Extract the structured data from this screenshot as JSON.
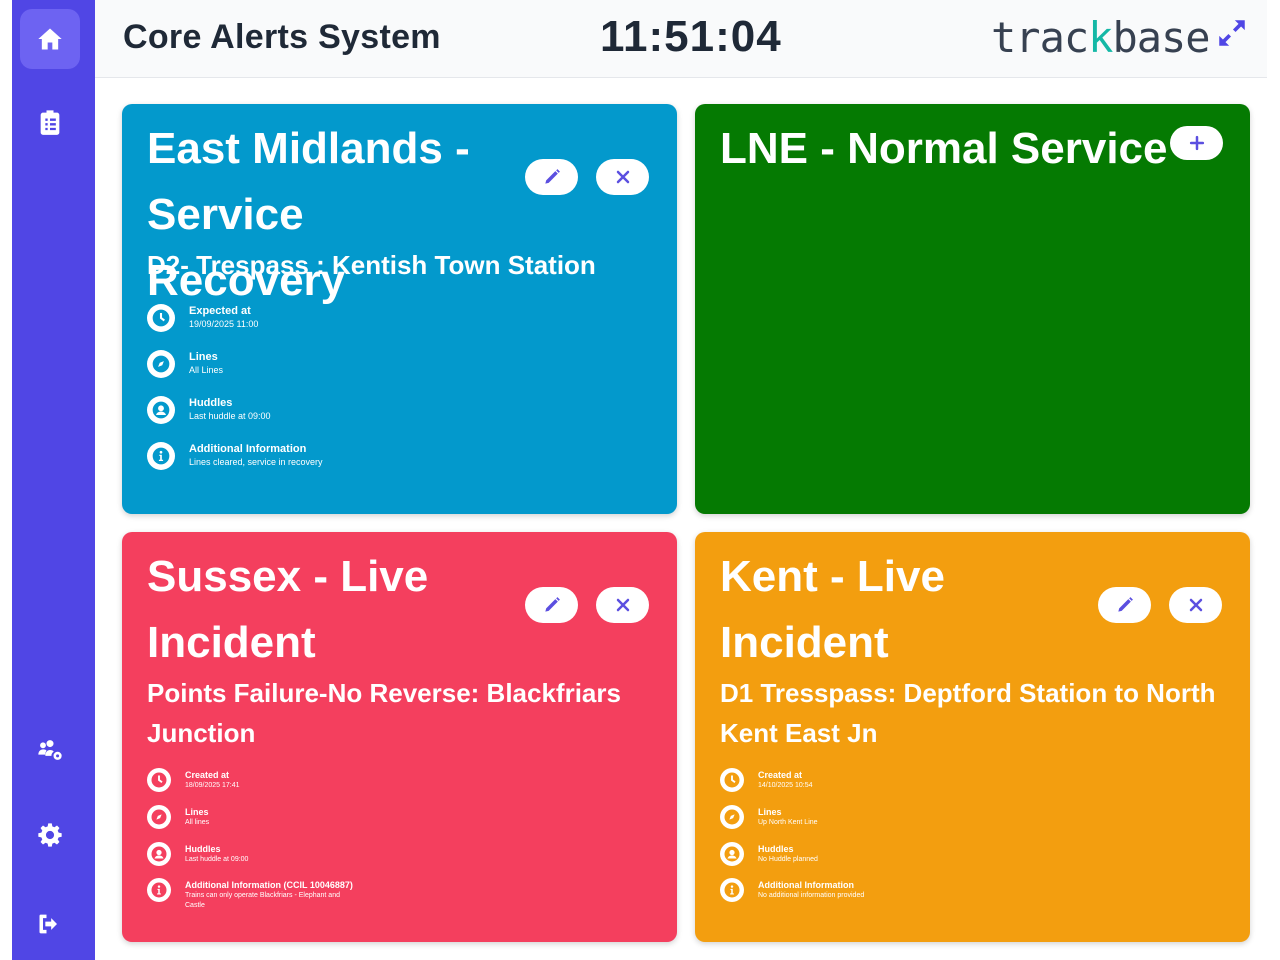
{
  "header": {
    "title": "Core Alerts System",
    "clock": "11:51:04",
    "logo_part1": "trac",
    "logo_k": "k",
    "logo_part2": "base"
  },
  "sidebar": {
    "items": [
      {
        "name": "home",
        "active": true
      },
      {
        "name": "clipboard-list"
      },
      {
        "name": "users-cog"
      },
      {
        "name": "settings"
      },
      {
        "name": "logout"
      }
    ]
  },
  "cards": [
    {
      "color": "#0399cc",
      "title": "East Midlands - Service Recovery",
      "subtitle": "D2- Trespass : Kentish Town Station",
      "details": [
        {
          "icon": "clock-icon",
          "label": "Expected at",
          "value": "19/09/2025 11:00"
        },
        {
          "icon": "compass-icon",
          "label": "Lines",
          "value": "All Lines"
        },
        {
          "icon": "user-icon",
          "label": "Huddles",
          "value": "Last huddle at 09:00"
        },
        {
          "icon": "info-icon",
          "label": "Additional Information",
          "value": "Lines cleared, service in recovery"
        }
      ]
    },
    {
      "color": "#057a02",
      "title": "LNE - Normal Service"
    },
    {
      "color": "#f43f5e",
      "title": "Sussex - Live Incident",
      "subtitle": "Points Failure-No Reverse: Blackfriars Junction",
      "details": [
        {
          "icon": "clock-icon",
          "label": "Created at",
          "value": "18/09/2025 17:41"
        },
        {
          "icon": "compass-icon",
          "label": "Lines",
          "value": "All lines"
        },
        {
          "icon": "user-icon",
          "label": "Huddles",
          "value": "Last huddle at 09:00"
        },
        {
          "icon": "info-icon",
          "label": "Additional Information (CCIL 10046887)",
          "value": "Trains can only operate Blackfriars - Elephant and Castle"
        }
      ]
    },
    {
      "color": "#f39e0f",
      "title": "Kent - Live Incident",
      "subtitle": "D1 Tresspass: Deptford Station to North Kent East Jn",
      "details": [
        {
          "icon": "clock-icon",
          "label": "Created at",
          "value": "14/10/2025 10:54"
        },
        {
          "icon": "compass-icon",
          "label": "Lines",
          "value": "Up North Kent Line"
        },
        {
          "icon": "user-icon",
          "label": "Huddles",
          "value": "No Huddle planned"
        },
        {
          "icon": "info-icon",
          "label": "Additional Information",
          "value": "No additional information provided"
        }
      ]
    }
  ],
  "colors": {
    "sidebar": "#5046e5",
    "icon_accent": "#5b4fe0"
  }
}
